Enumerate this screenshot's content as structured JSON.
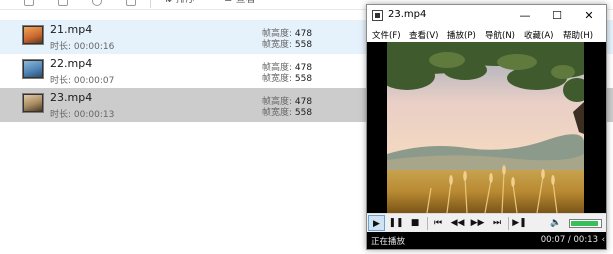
{
  "explorer": {
    "toolbar": {
      "sort_label": "排序",
      "view_label": "查看"
    },
    "files": [
      {
        "name": "21.mp4",
        "duration_label": "时长:",
        "duration": "00:00:16",
        "height_label": "帧高度:",
        "height": "478",
        "width_label": "帧宽度:",
        "width": "558",
        "state": "hover"
      },
      {
        "name": "22.mp4",
        "duration_label": "时长:",
        "duration": "00:00:07",
        "height_label": "帧高度:",
        "height": "478",
        "width_label": "帧宽度:",
        "width": "558",
        "state": "normal"
      },
      {
        "name": "23.mp4",
        "duration_label": "时长:",
        "duration": "00:00:13",
        "height_label": "帧高度:",
        "height": "478",
        "width_label": "帧宽度:",
        "width": "558",
        "state": "selected"
      }
    ]
  },
  "player": {
    "title": "23.mp4",
    "window_buttons": {
      "minimize": "—",
      "maximize": "☐",
      "close": "✕"
    },
    "menu": [
      "文件(F)",
      "查看(V)",
      "播放(P)",
      "导航(N)",
      "收藏(A)",
      "帮助(H)"
    ],
    "controls": {
      "play": "▶",
      "pause": "❚❚",
      "stop": "■",
      "prev": "⏮",
      "rewind": "◀◀",
      "forward": "▶▶",
      "next": "⏭",
      "frame_step": "▶❚",
      "volume_icon": "🔈"
    },
    "volume_level": 0.92,
    "status": "正在播放",
    "time": "00:07 / 00:13",
    "time_edge": "‹"
  }
}
